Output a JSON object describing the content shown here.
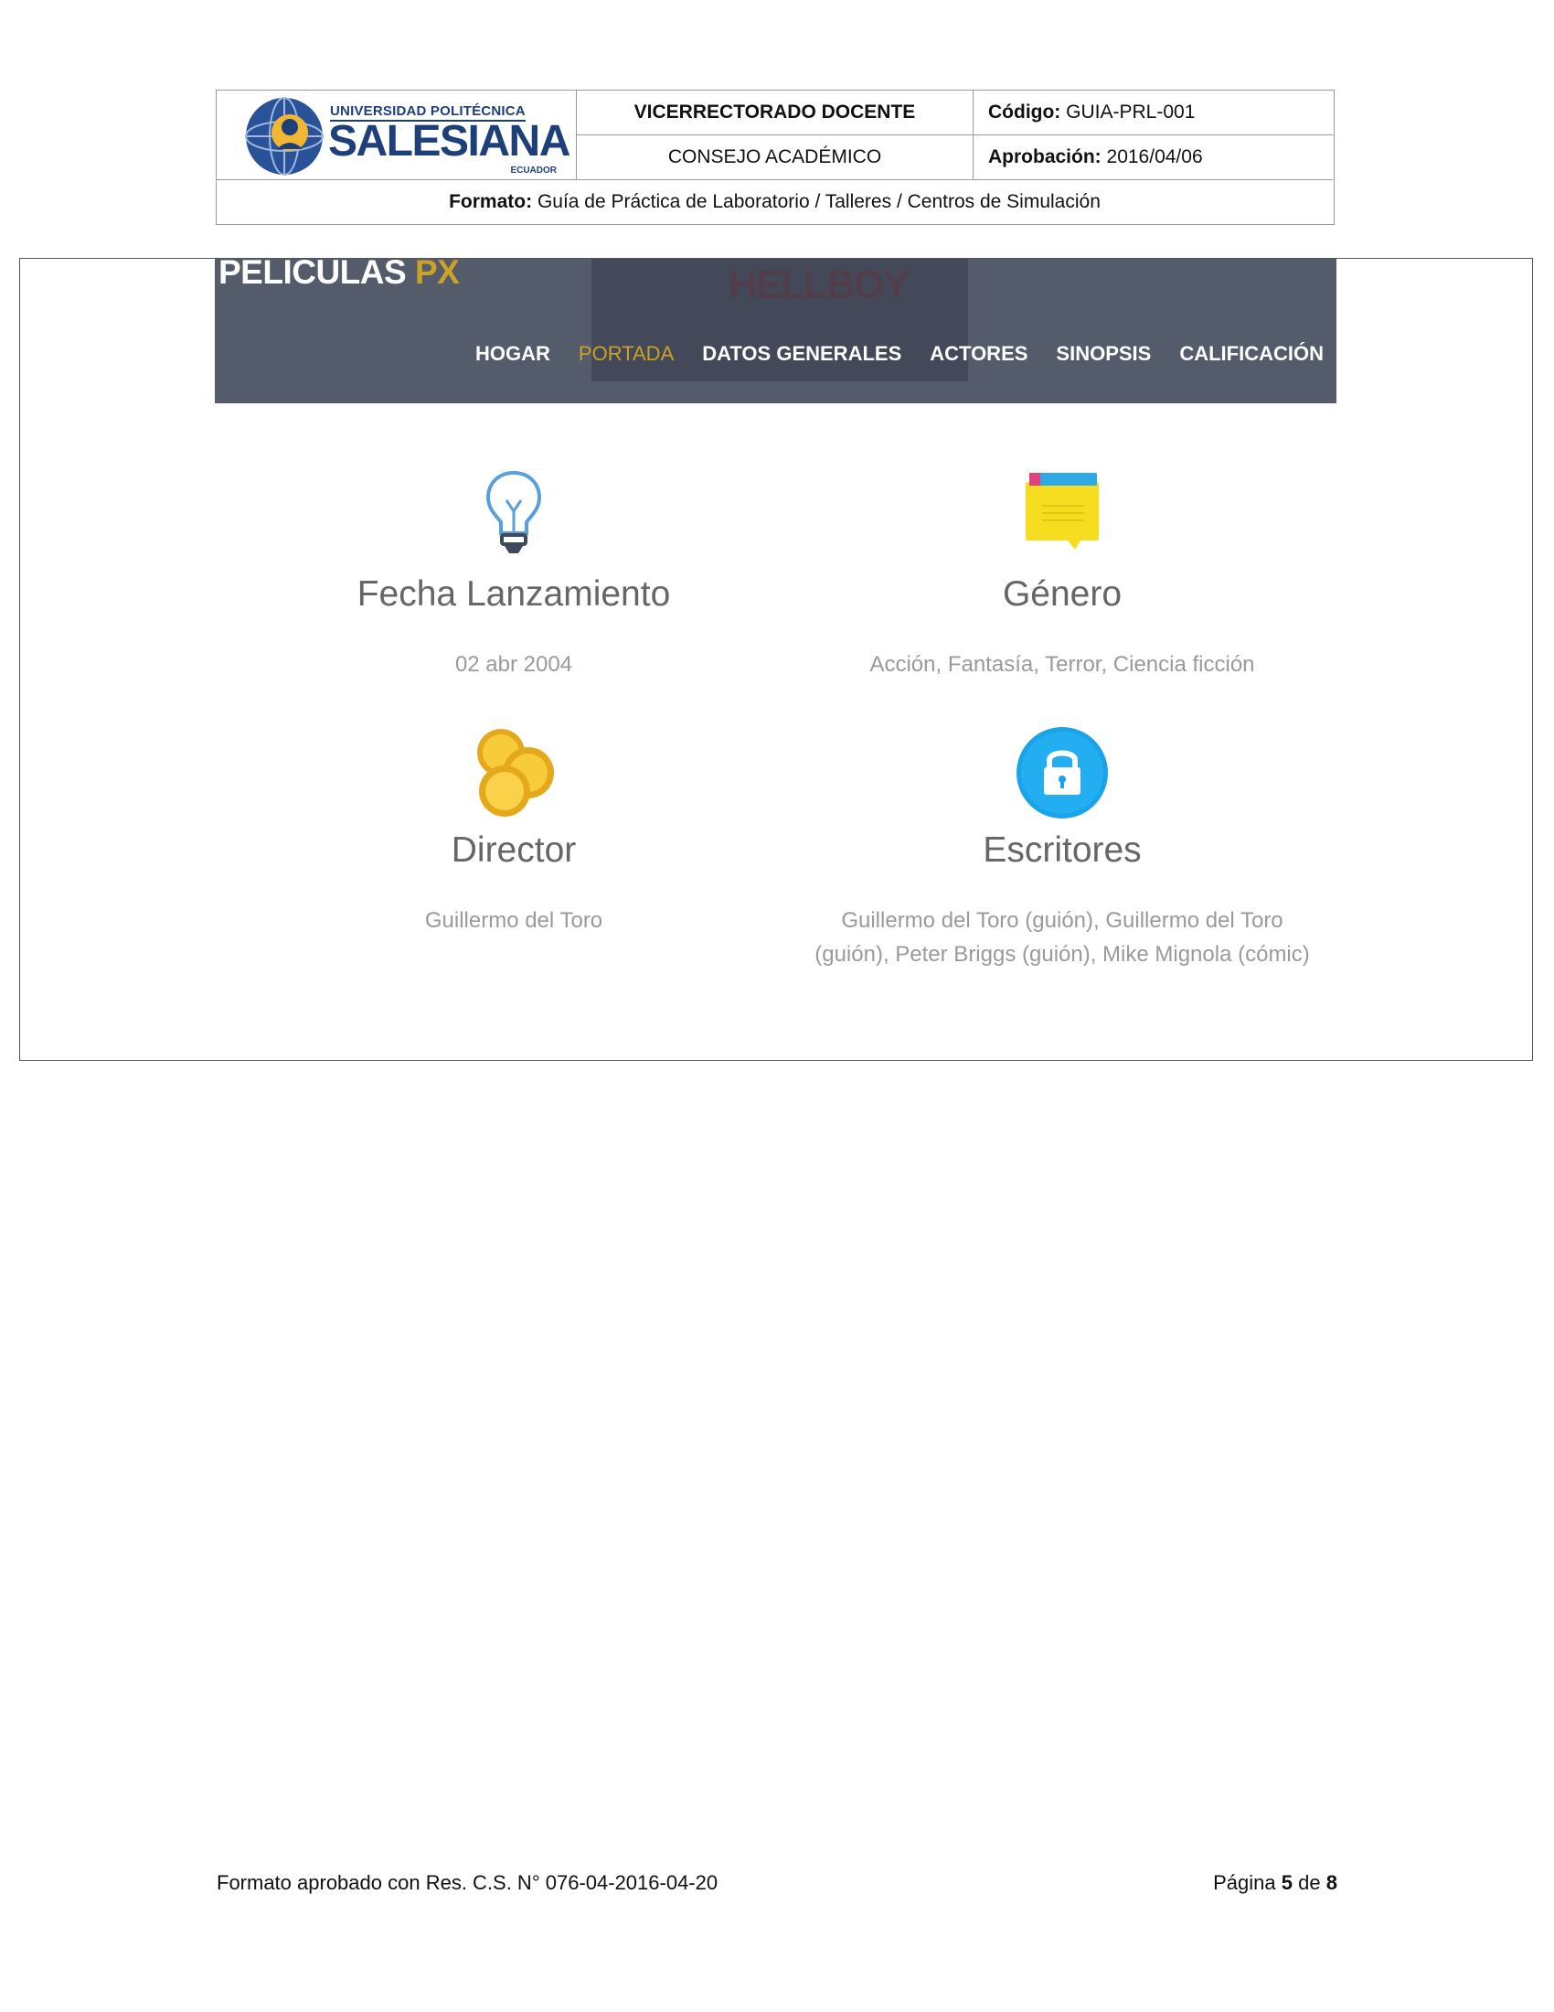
{
  "header": {
    "logo": {
      "line1": "UNIVERSIDAD POLITÉCNICA",
      "line2": "SALESIANA",
      "line3": "ECUADOR"
    },
    "vicerrectorado": "VICERRECTORADO DOCENTE",
    "codigo_label": "Código:",
    "codigo_value": "GUIA-PRL-001",
    "consejo": "CONSEJO ACADÉMICO",
    "aprobacion_label": "Aprobación:",
    "aprobacion_value": "2016/04/06",
    "formato_label": "Formato:",
    "formato_value": "Guía de Práctica de Laboratorio / Talleres / Centros de Simulación"
  },
  "screenshot": {
    "brand": "PELICULAS",
    "brand_accent": "PX",
    "poster_text": "HELLBOY",
    "nav": [
      "HOGAR",
      "PORTADA",
      "DATOS GENERALES",
      "ACTORES",
      "SINOPSIS",
      "CALIFICACIÓN"
    ],
    "active_nav": "PORTADA",
    "features": {
      "release": {
        "title": "Fecha Lanzamiento",
        "value": "02 abr 2004",
        "icon": "lightbulb-icon"
      },
      "genre": {
        "title": "Género",
        "value": "Acción, Fantasía, Terror, Ciencia ficción",
        "icon": "sticky-note-icon"
      },
      "director": {
        "title": "Director",
        "value": "Guillermo del Toro",
        "icon": "coins-icon"
      },
      "writers": {
        "title": "Escritores",
        "value": "Guillermo del Toro (guión), Guillermo del Toro (guión), Peter Briggs (guión), Mike Mignola (cómic)",
        "icon": "lock-icon"
      }
    },
    "colors": {
      "navbar": "#545b6b",
      "accent": "#c9a227",
      "lock_blue": "#1aa3e8",
      "coin": "#f2c029",
      "note": "#f7dd1f"
    }
  },
  "footer": {
    "left": "Formato aprobado con Res. C.S. N° 076-04-2016-04-20",
    "page_label": "Página",
    "page_current": "5",
    "page_sep": "de",
    "page_total": "8"
  }
}
